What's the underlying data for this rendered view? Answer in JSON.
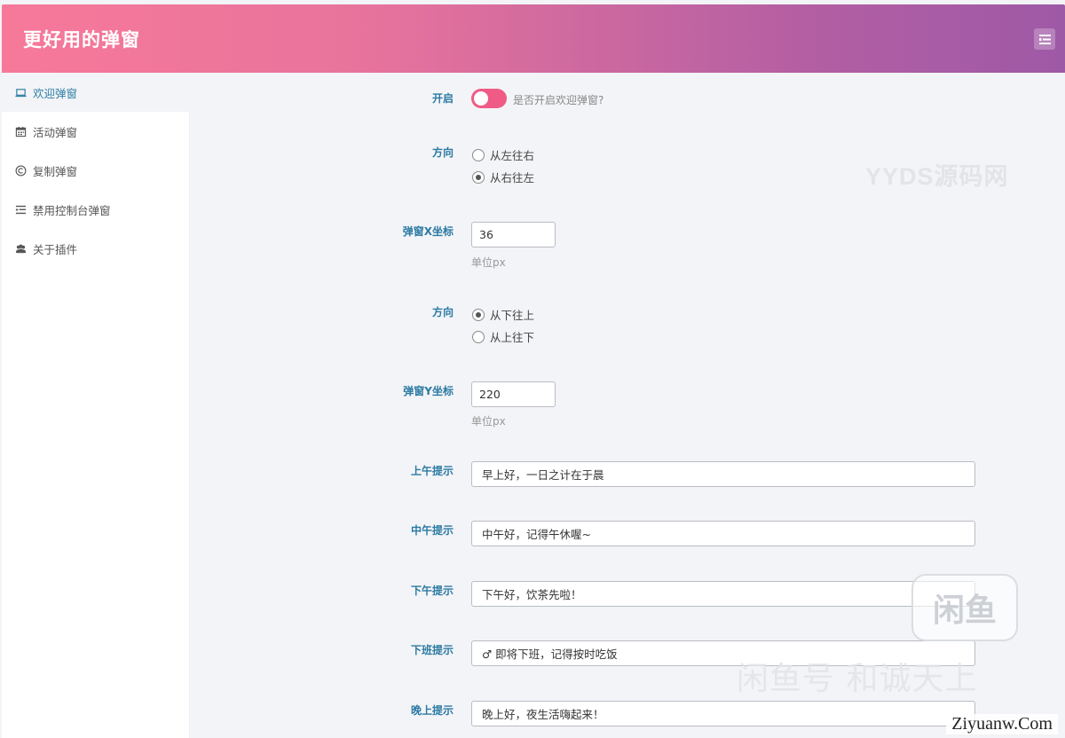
{
  "header": {
    "title": "更好用的弹窗",
    "menu_icon": "menu-icon"
  },
  "sidebar": {
    "items": [
      {
        "label": "欢迎弹窗",
        "icon": "laptop-icon",
        "active": true
      },
      {
        "label": "活动弹窗",
        "icon": "calendar-icon",
        "active": false
      },
      {
        "label": "复制弹窗",
        "icon": "copyright-icon",
        "active": false
      },
      {
        "label": "禁用控制台弹窗",
        "icon": "console-icon",
        "active": false
      },
      {
        "label": "关于插件",
        "icon": "users-icon",
        "active": false
      }
    ]
  },
  "watermark": "YYDS源码网",
  "form": {
    "enable": {
      "label": "开启",
      "checked": true,
      "description": "是否开启欢迎弹窗?"
    },
    "direction_x": {
      "label": "方向",
      "options": [
        "从左往右",
        "从右往左"
      ],
      "selected": "从右往左"
    },
    "x_coord": {
      "label": "弹窗X坐标",
      "value": "36",
      "hint": "单位px"
    },
    "direction_y": {
      "label": "方向",
      "options": [
        "从下往上",
        "从上往下"
      ],
      "selected": "从下往上"
    },
    "y_coord": {
      "label": "弹窗Y坐标",
      "value": "220",
      "hint": "单位px"
    },
    "morning": {
      "label": "上午提示",
      "value": "早上好，一日之计在于晨"
    },
    "noon": {
      "label": "中午提示",
      "value": "中午好，记得午休喔~"
    },
    "afternoon": {
      "label": "下午提示",
      "value": "下午好，饮茶先啦！"
    },
    "off_work": {
      "label": "下班提示",
      "value": "♂ 即将下班，记得按时吃饭"
    },
    "evening": {
      "label": "晚上提示",
      "value": "晚上好，夜生活嗨起来！"
    }
  },
  "overlay": {
    "badge": "闲鱼",
    "text": "闲鱼号 和诚天上",
    "site": "Ziyuanw.Com"
  },
  "colors": {
    "accent": "#2c7aa3",
    "toggle_on": "#ef5b86",
    "header_start": "#f7799a",
    "header_end": "#9e59a6"
  }
}
